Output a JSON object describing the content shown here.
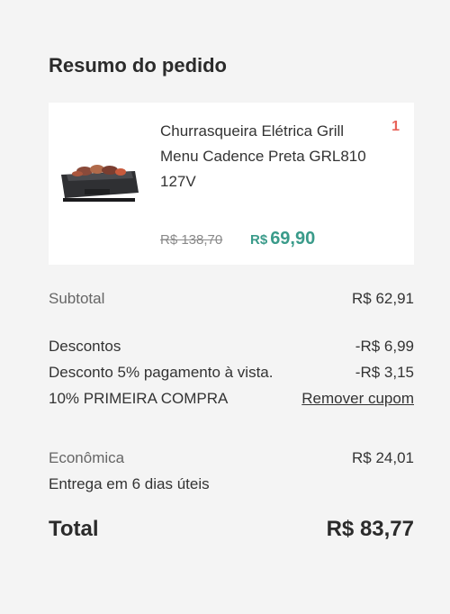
{
  "summary": {
    "title": "Resumo do pedido",
    "product": {
      "name": "Churrasqueira Elétrica Grill Menu Cadence Preta GRL810 127V",
      "quantity": "1",
      "old_price": "R$ 138,70",
      "currency": "R$",
      "price": "69,90"
    },
    "subtotal_label": "Subtotal",
    "subtotal_value": "R$ 62,91",
    "discounts_label": "Descontos",
    "discounts_value": "-R$ 6,99",
    "cash_discount_label": "Desconto 5% pagamento à vista.",
    "cash_discount_value": "-R$ 3,15",
    "coupon_label": "10% PRIMEIRA COMPRA",
    "remove_coupon": "Remover cupom",
    "shipping_label": "Econômica",
    "shipping_value": "R$ 24,01",
    "delivery_time": "Entrega em 6 dias úteis",
    "total_label": "Total",
    "total_value": "R$ 83,77"
  },
  "colors": {
    "accent": "#3a9b8a",
    "quantity": "#e8635a",
    "background": "#f4f4f4"
  },
  "icons": [
    "electric-grill-product-image"
  ]
}
